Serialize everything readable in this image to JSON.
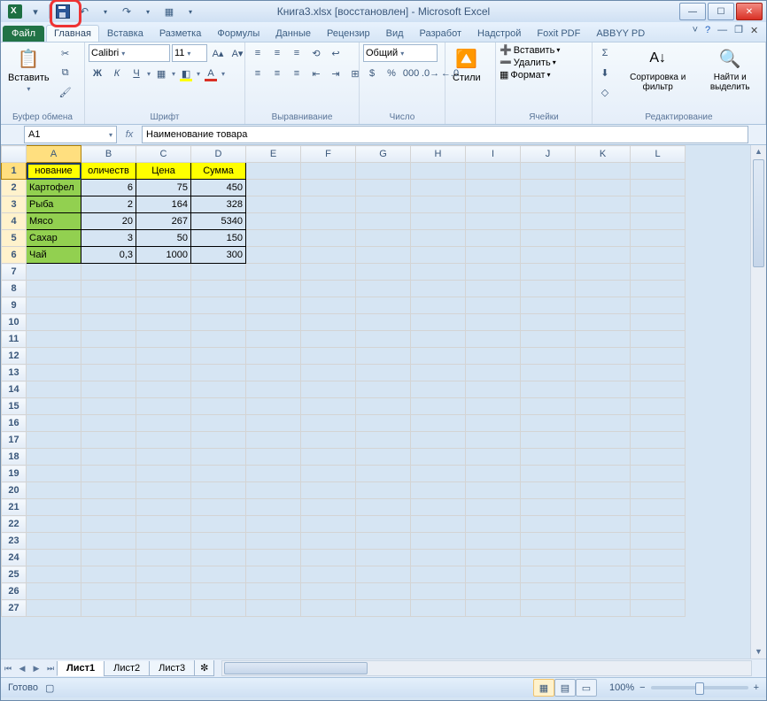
{
  "title": "Книга3.xlsx [восстановлен] - Microsoft Excel",
  "tabs": {
    "file": "Файл",
    "items": [
      "Главная",
      "Вставка",
      "Разметка",
      "Формулы",
      "Данные",
      "Рецензир",
      "Вид",
      "Разработ",
      "Надстрой",
      "Foxit PDF",
      "ABBYY PD"
    ],
    "active": 0
  },
  "ribbon": {
    "paste": "Вставить",
    "clipboard": "Буфер обмена",
    "font_name": "Calibri",
    "font_size": "11",
    "font_group": "Шрифт",
    "align_group": "Выравнивание",
    "number_format": "Общий",
    "number_group": "Число",
    "styles": "Стили",
    "insert": "Вставить",
    "delete": "Удалить",
    "format": "Формат",
    "cells_group": "Ячейки",
    "sort": "Сортировка и фильтр",
    "find": "Найти и выделить",
    "editing_group": "Редактирование"
  },
  "name_box": "A1",
  "formula": "Наименование товара",
  "columns": [
    "A",
    "B",
    "C",
    "D",
    "E",
    "F",
    "G",
    "H",
    "I",
    "J",
    "K",
    "L"
  ],
  "headers": {
    "A": "нование",
    "B": "оличеств",
    "C": "Цена",
    "D": "Сумма"
  },
  "rows": [
    {
      "A": "Картофел",
      "B": "6",
      "C": "75",
      "D": "450"
    },
    {
      "A": "Рыба",
      "B": "2",
      "C": "164",
      "D": "328"
    },
    {
      "A": "Мясо",
      "B": "20",
      "C": "267",
      "D": "5340"
    },
    {
      "A": "Сахар",
      "B": "3",
      "C": "50",
      "D": "150"
    },
    {
      "A": "Чай",
      "B": "0,3",
      "C": "1000",
      "D": "300"
    }
  ],
  "row_count": 27,
  "sheets": [
    "Лист1",
    "Лист2",
    "Лист3"
  ],
  "active_sheet": 0,
  "status": "Готово",
  "zoom": "100%"
}
